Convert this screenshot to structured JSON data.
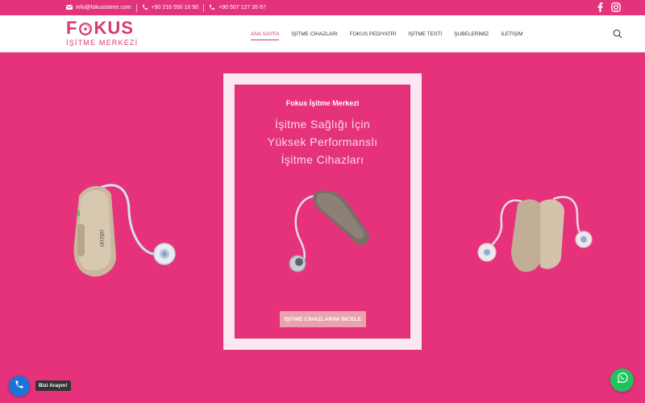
{
  "colors": {
    "brand_pink": "#e6327b",
    "logo_pink": "#d63a6e",
    "cta_pink": "#e8a3ae",
    "call_blue": "#1e73d8",
    "whatsapp_green": "#22c35e"
  },
  "topbar": {
    "email": "info@fokusisitme.com",
    "phone1": "+90 216 550 10 90",
    "phone2": "+90 507 127 35 67",
    "social": [
      "facebook-icon",
      "instagram-icon"
    ]
  },
  "header": {
    "logo_brand_left": "F",
    "logo_brand_right": "KUS",
    "logo_sub": "İŞİTME MERKEZİ",
    "nav": [
      {
        "label": "ANA SAYFA",
        "active": true
      },
      {
        "label": "İŞİTME CİHAZLARI",
        "active": false
      },
      {
        "label": "FOKUS PEDİYATRİ",
        "active": false
      },
      {
        "label": "İŞİTME TESTİ",
        "active": false
      },
      {
        "label": "ŞUBELERİMİZ",
        "active": false
      },
      {
        "label": "İLETİŞİM",
        "active": false
      }
    ]
  },
  "hero": {
    "card_title": "Fokus İşitme Merkezi",
    "heading_lines": [
      "İşitme Sağlığı İçin",
      "Yüksek Performanslı",
      "İşitme Cihazları"
    ],
    "cta_label": "İŞİTME CİHAZLARINI İNCELE"
  },
  "floating": {
    "call_label": "Bizi Arayın!"
  }
}
